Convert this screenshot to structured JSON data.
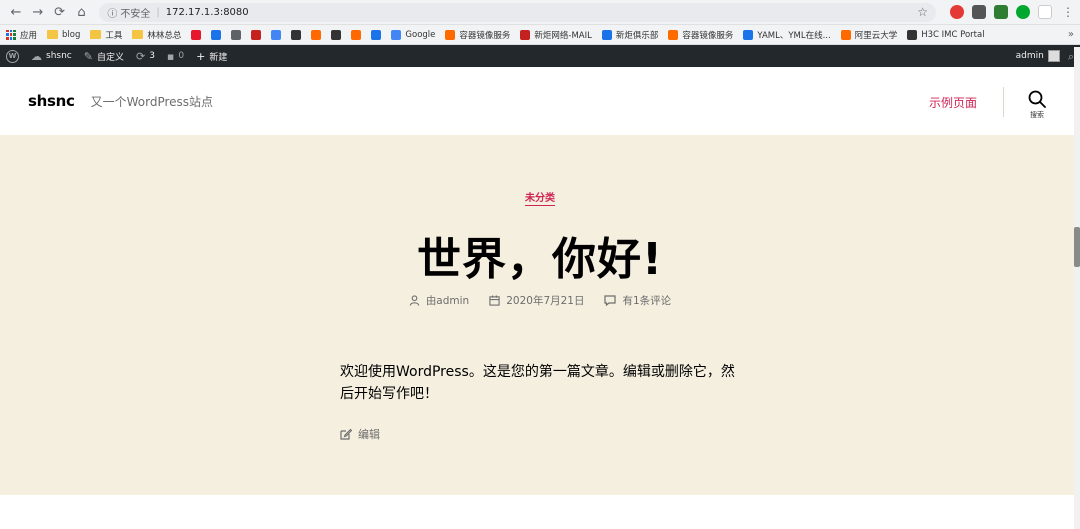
{
  "browser": {
    "security_label": "不安全",
    "url": "172.17.1.3:8080",
    "bookmarks": [
      {
        "label": "应用",
        "color": "#d93025"
      },
      {
        "label": "blog",
        "color": "#f4c542"
      },
      {
        "label": "工具",
        "color": "#f4c542"
      },
      {
        "label": "林林总总",
        "color": "#f4c542"
      },
      {
        "label": "",
        "color": "#e6162d"
      },
      {
        "label": "",
        "color": "#1a73e8"
      },
      {
        "label": "",
        "color": "#5f6368"
      },
      {
        "label": "",
        "color": "#c5221f"
      },
      {
        "label": "",
        "color": "#4285f4"
      },
      {
        "label": "",
        "color": "#333333"
      },
      {
        "label": "",
        "color": "#ff6a00"
      },
      {
        "label": "",
        "color": "#333333"
      },
      {
        "label": "",
        "color": "#ff6a00"
      },
      {
        "label": "",
        "color": "#1a73e8"
      },
      {
        "label": "Google",
        "color": "#4285f4"
      },
      {
        "label": "容器镜像服务",
        "color": "#ff6a00"
      },
      {
        "label": "新炬网络-MAIL",
        "color": "#c5221f"
      },
      {
        "label": "新炬俱乐部",
        "color": "#1a73e8"
      },
      {
        "label": "容器镜像服务",
        "color": "#ff6a00"
      },
      {
        "label": "YAML、YML在线...",
        "color": "#1a73e8"
      },
      {
        "label": "阿里云大学",
        "color": "#ff6a00"
      },
      {
        "label": "H3C IMC Portal",
        "color": "#333333"
      }
    ],
    "more_label": "»"
  },
  "admin_bar": {
    "site_name": "shsnc",
    "customize": "自定义",
    "updates_count": "3",
    "comments_count": "0",
    "new_label": "新建",
    "greeting_user": "admin"
  },
  "site": {
    "title": "shsnc",
    "description": "又一个WordPress站点",
    "menu_item": "示例页面",
    "search_label": "搜索"
  },
  "post": {
    "category": "未分类",
    "title": "世界，你好!",
    "author": "由admin",
    "date": "2020年7月21日",
    "comments": "有1条评论",
    "content": "欢迎使用WordPress。这是您的第一篇文章。编辑或删除它，然后开始写作吧！",
    "edit_label": "编辑"
  },
  "colors": {
    "accent": "#cd2653",
    "hero_bg": "#f5efe0",
    "admin_bar_bg": "#23282d"
  }
}
